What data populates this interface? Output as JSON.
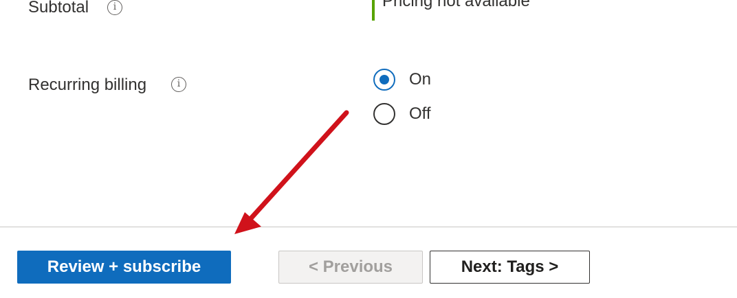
{
  "subtotal": {
    "label": "Subtotal",
    "info_icon": "info-icon",
    "value": "Pricing not available",
    "accent_color": "#57a300"
  },
  "recurring_billing": {
    "label": "Recurring billing",
    "info_icon": "info-icon",
    "options": [
      {
        "label": "On",
        "selected": true
      },
      {
        "label": "Off",
        "selected": false
      }
    ],
    "selected_color": "#0f6cbd"
  },
  "footer": {
    "review_subscribe_label": "Review + subscribe",
    "previous_label": "< Previous",
    "previous_disabled": true,
    "next_label": "Next: Tags >",
    "primary_color": "#0f6cbd"
  },
  "annotation": {
    "arrow_color": "#d0121b"
  }
}
